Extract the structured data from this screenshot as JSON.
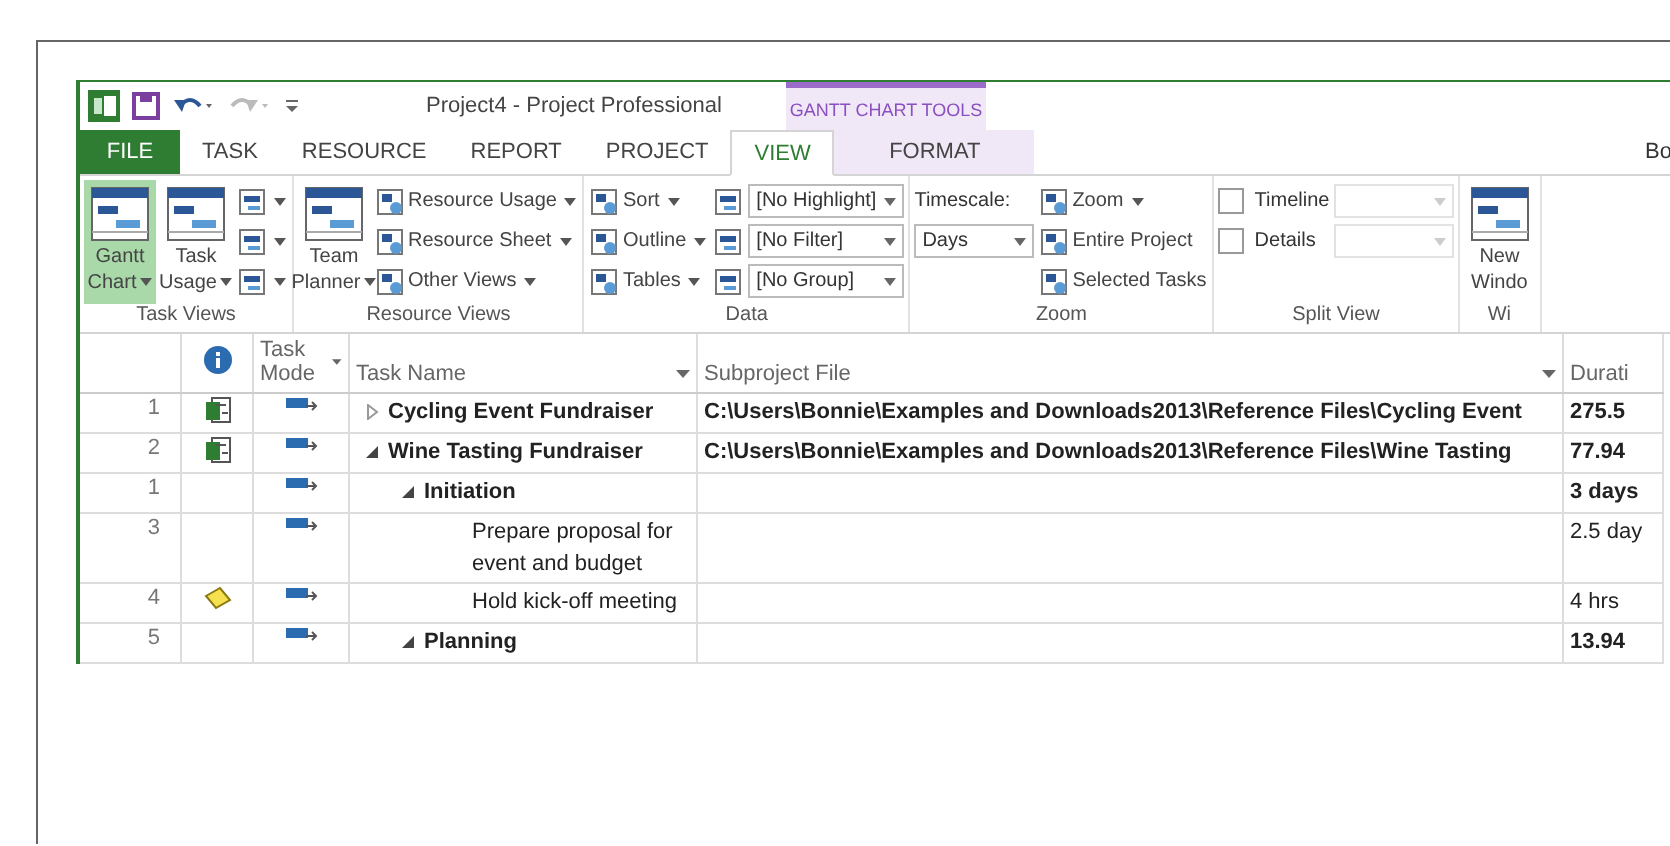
{
  "title_bar": {
    "title": "Project4 - Project Professional",
    "context_header": "GANTT CHART TOOLS"
  },
  "tabs": [
    {
      "label": "FILE",
      "kind": "file",
      "selected": false
    },
    {
      "label": "TASK",
      "kind": "normal",
      "selected": false
    },
    {
      "label": "RESOURCE",
      "kind": "normal",
      "selected": false
    },
    {
      "label": "REPORT",
      "kind": "normal",
      "selected": false
    },
    {
      "label": "PROJECT",
      "kind": "normal",
      "selected": false
    },
    {
      "label": "VIEW",
      "kind": "normal",
      "selected": true
    },
    {
      "label": "FORMAT",
      "kind": "contextual",
      "selected": false
    }
  ],
  "user": "Bo",
  "ribbon_groups": [
    {
      "label": "Task Views",
      "columns": [
        {
          "kind": "large",
          "lines": [
            "Gantt",
            "Chart"
          ],
          "dropdown": true,
          "selected": true
        },
        {
          "kind": "large",
          "lines": [
            "Task",
            "Usage"
          ],
          "dropdown": true,
          "selected": false
        },
        {
          "kind": "stack",
          "items": [
            {
              "kind": "icon",
              "dropdown": true
            },
            {
              "kind": "icon",
              "dropdown": true
            },
            {
              "kind": "icon",
              "dropdown": true
            }
          ]
        }
      ]
    },
    {
      "label": "Resource Views",
      "columns": [
        {
          "kind": "large",
          "lines": [
            "Team",
            "Planner"
          ],
          "dropdown": true,
          "selected": false
        },
        {
          "kind": "stack",
          "items": [
            {
              "kind": "button",
              "label": "Resource Usage",
              "dropdown": true
            },
            {
              "kind": "button",
              "label": "Resource Sheet",
              "dropdown": true
            },
            {
              "kind": "button",
              "label": "Other Views",
              "dropdown": true
            }
          ]
        }
      ]
    },
    {
      "label": "Data",
      "columns": [
        {
          "kind": "stack",
          "items": [
            {
              "kind": "button",
              "label": "Sort",
              "dropdown": true
            },
            {
              "kind": "button",
              "label": "Outline",
              "dropdown": true
            },
            {
              "kind": "button",
              "label": "Tables",
              "dropdown": true
            }
          ]
        },
        {
          "kind": "stack",
          "items": [
            {
              "kind": "icon",
              "dropdown": false
            },
            {
              "kind": "icon",
              "dropdown": false
            },
            {
              "kind": "icon",
              "dropdown": false
            }
          ]
        },
        {
          "kind": "stack",
          "items": [
            {
              "kind": "select",
              "value": "[No Highlight]",
              "disabled": false
            },
            {
              "kind": "select",
              "value": "[No Filter]",
              "disabled": false
            },
            {
              "kind": "select",
              "value": "[No Group]",
              "disabled": false
            }
          ]
        }
      ]
    },
    {
      "label": "Zoom",
      "columns": [
        {
          "kind": "stack",
          "items": [
            {
              "kind": "label",
              "label": "Timescale:"
            },
            {
              "kind": "select",
              "value": "Days",
              "disabled": false
            }
          ]
        },
        {
          "kind": "stack",
          "items": [
            {
              "kind": "button",
              "label": "Zoom",
              "dropdown": true
            },
            {
              "kind": "button",
              "label": "Entire Project",
              "dropdown": false
            },
            {
              "kind": "button",
              "label": "Selected Tasks",
              "dropdown": false
            }
          ]
        }
      ]
    },
    {
      "label": "Split View",
      "columns": [
        {
          "kind": "stack",
          "items": [
            {
              "kind": "checkbox",
              "label": "Timeline",
              "checked": false
            },
            {
              "kind": "checkbox",
              "label": "Details",
              "checked": false
            }
          ]
        },
        {
          "kind": "stack",
          "items": [
            {
              "kind": "select",
              "disabled": true
            },
            {
              "kind": "select",
              "disabled": true
            }
          ]
        }
      ]
    },
    {
      "label": "Wi",
      "columns": [
        {
          "kind": "large",
          "lines": [
            "New",
            "Windo"
          ],
          "dropdown": false,
          "selected": false
        }
      ]
    }
  ],
  "table": {
    "columns": [
      {
        "kind": "id"
      },
      {
        "kind": "indicators"
      },
      {
        "kind": "mode",
        "label": "Task Mode"
      },
      {
        "kind": "name",
        "label": "Task Name"
      },
      {
        "kind": "subproject",
        "label": "Subproject File"
      },
      {
        "kind": "duration",
        "label": "Durati"
      }
    ],
    "rows": [
      {
        "id": "1",
        "indicator": {
          "kind": "project"
        },
        "name": "Cycling Event Fundraiser",
        "expanded": false,
        "subproject": "C:\\Users\\Bonnie\\Examples and Downloads2013\\Reference Files\\Cycling Event",
        "duration": "275.5"
      },
      {
        "id": "2",
        "indicator": {
          "kind": "project"
        },
        "name": "Wine Tasting Fundraiser",
        "expanded": true,
        "subproject": "C:\\Users\\Bonnie\\Examples and Downloads2013\\Reference Files\\Wine Tasting",
        "duration": "77.94",
        "children": [
          {
            "id": "1",
            "name": "Initiation",
            "expanded": true,
            "duration": "3 days",
            "children": [
              {
                "id": "3",
                "name": "Prepare proposal for event and budget",
                "duration": "2.5 day"
              },
              {
                "id": "4",
                "indicator": {
                  "kind": "note"
                },
                "name": "Hold kick-off meeting",
                "duration": "4 hrs"
              }
            ]
          },
          {
            "id": "5",
            "name": "Planning",
            "expanded": true,
            "duration": "13.94"
          }
        ]
      }
    ]
  }
}
